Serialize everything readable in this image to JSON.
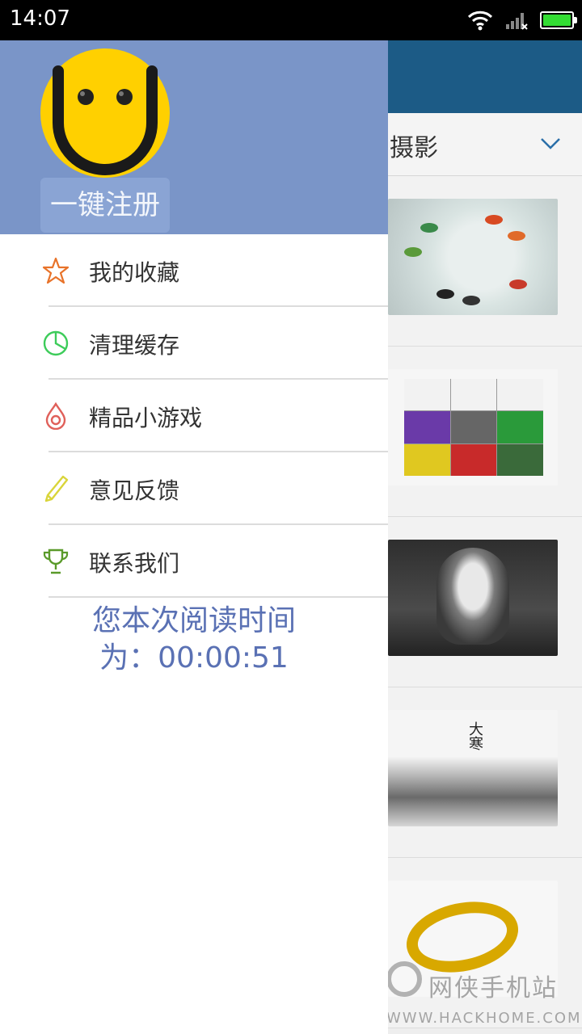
{
  "status_bar": {
    "time": "14:07",
    "icons": [
      "wifi-icon",
      "signal-icon",
      "battery-icon"
    ]
  },
  "drawer": {
    "register_label": "一键注册",
    "menu": [
      {
        "label": "我的收藏",
        "icon": "star-icon",
        "color": "#e8732a"
      },
      {
        "label": "清理缓存",
        "icon": "pie-chart-icon",
        "color": "#3dcc5a"
      },
      {
        "label": "精品小游戏",
        "icon": "drop-icon",
        "color": "#e0605a"
      },
      {
        "label": "意见反馈",
        "icon": "pencil-icon",
        "color": "#d9d53a"
      },
      {
        "label": "联系我们",
        "icon": "trophy-icon",
        "color": "#5a9a2a"
      }
    ],
    "reading_time_line1": "您本次阅读时间",
    "reading_time_line2": "为：00:00:51"
  },
  "background": {
    "tab_label": "摄影",
    "thumb4_text": "大寒"
  },
  "watermark": {
    "cn": "网侠手机站",
    "en": "WWW.HACKHOME.COM"
  },
  "colors": {
    "drawer_header": "#7a95c8",
    "app_header": "#1c5b86",
    "reading_text": "#5a71b4",
    "avatar_yellow": "#ffd000"
  }
}
